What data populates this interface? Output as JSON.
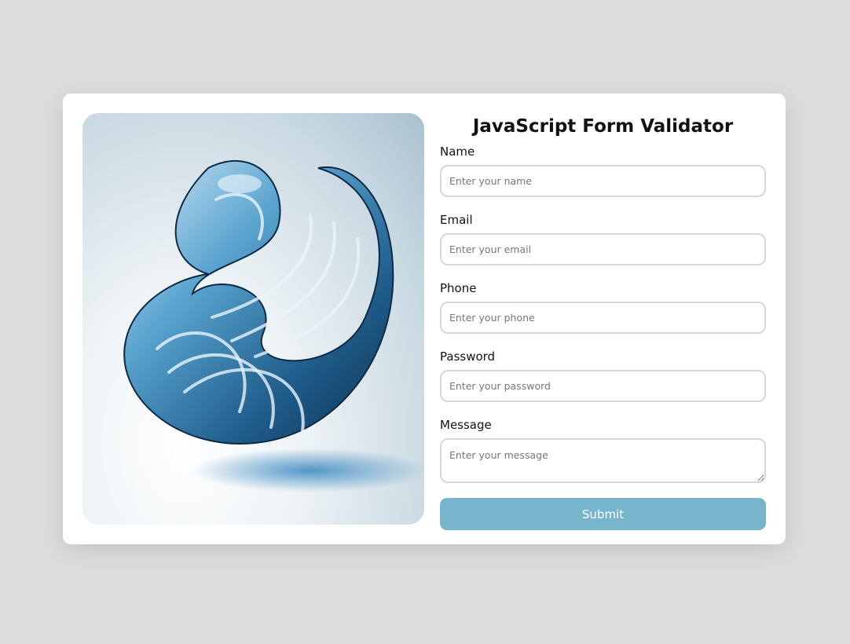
{
  "form": {
    "title": "JavaScript Form Validator",
    "fields": [
      {
        "label": "Name",
        "placeholder": "Enter your name"
      },
      {
        "label": "Email",
        "placeholder": "Enter your email"
      },
      {
        "label": "Phone",
        "placeholder": "Enter your phone"
      },
      {
        "label": "Password",
        "placeholder": "Enter your password"
      },
      {
        "label": "Message",
        "placeholder": "Enter your message"
      }
    ],
    "submit_label": "Submit"
  },
  "colors": {
    "page_background": "#dcdcdc",
    "card_background": "#ffffff",
    "submit_button": "#77b5cd",
    "input_border": "#d7d7d7"
  }
}
